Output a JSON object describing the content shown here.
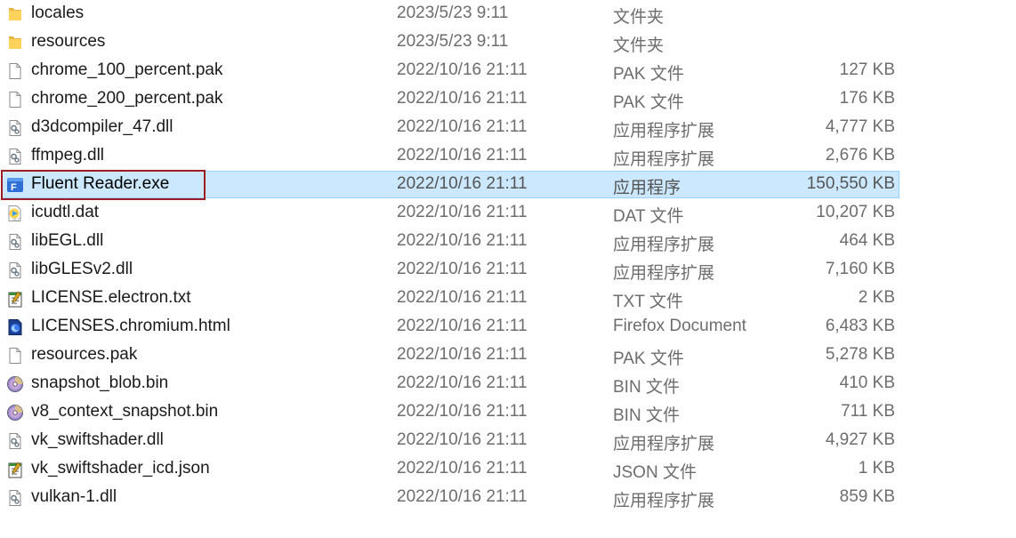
{
  "files": [
    {
      "name": "locales",
      "date": "2023/5/23 9:11",
      "type": "文件夹",
      "size": "",
      "icon": "folder-icon",
      "selected": false
    },
    {
      "name": "resources",
      "date": "2023/5/23 9:11",
      "type": "文件夹",
      "size": "",
      "icon": "folder-icon",
      "selected": false
    },
    {
      "name": "chrome_100_percent.pak",
      "date": "2022/10/16 21:11",
      "type": "PAK 文件",
      "size": "127 KB",
      "icon": "blank-file-icon",
      "selected": false
    },
    {
      "name": "chrome_200_percent.pak",
      "date": "2022/10/16 21:11",
      "type": "PAK 文件",
      "size": "176 KB",
      "icon": "blank-file-icon",
      "selected": false
    },
    {
      "name": "d3dcompiler_47.dll",
      "date": "2022/10/16 21:11",
      "type": "应用程序扩展",
      "size": "4,777 KB",
      "icon": "dll-file-icon",
      "selected": false
    },
    {
      "name": "ffmpeg.dll",
      "date": "2022/10/16 21:11",
      "type": "应用程序扩展",
      "size": "2,676 KB",
      "icon": "dll-file-icon",
      "selected": false
    },
    {
      "name": "Fluent Reader.exe",
      "date": "2022/10/16 21:11",
      "type": "应用程序",
      "size": "150,550 KB",
      "icon": "fluent-reader-app-icon",
      "selected": true
    },
    {
      "name": "icudtl.dat",
      "date": "2022/10/16 21:11",
      "type": "DAT 文件",
      "size": "10,207 KB",
      "icon": "media-player-file-icon",
      "selected": false
    },
    {
      "name": "libEGL.dll",
      "date": "2022/10/16 21:11",
      "type": "应用程序扩展",
      "size": "464 KB",
      "icon": "dll-file-icon",
      "selected": false
    },
    {
      "name": "libGLESv2.dll",
      "date": "2022/10/16 21:11",
      "type": "应用程序扩展",
      "size": "7,160 KB",
      "icon": "dll-file-icon",
      "selected": false
    },
    {
      "name": "LICENSE.electron.txt",
      "date": "2022/10/16 21:11",
      "type": "TXT 文件",
      "size": "2 KB",
      "icon": "notepad-file-icon",
      "selected": false
    },
    {
      "name": "LICENSES.chromium.html",
      "date": "2022/10/16 21:11",
      "type": "Firefox Document",
      "size": "6,483 KB",
      "icon": "firefox-document-icon",
      "selected": false
    },
    {
      "name": "resources.pak",
      "date": "2022/10/16 21:11",
      "type": "PAK 文件",
      "size": "5,278 KB",
      "icon": "blank-file-icon",
      "selected": false
    },
    {
      "name": "snapshot_blob.bin",
      "date": "2022/10/16 21:11",
      "type": "BIN 文件",
      "size": "410 KB",
      "icon": "disc-file-icon",
      "selected": false
    },
    {
      "name": "v8_context_snapshot.bin",
      "date": "2022/10/16 21:11",
      "type": "BIN 文件",
      "size": "711 KB",
      "icon": "disc-file-icon",
      "selected": false
    },
    {
      "name": "vk_swiftshader.dll",
      "date": "2022/10/16 21:11",
      "type": "应用程序扩展",
      "size": "4,927 KB",
      "icon": "dll-file-icon",
      "selected": false
    },
    {
      "name": "vk_swiftshader_icd.json",
      "date": "2022/10/16 21:11",
      "type": "JSON 文件",
      "size": "1 KB",
      "icon": "notepad-file-icon",
      "selected": false
    },
    {
      "name": "vulkan-1.dll",
      "date": "2022/10/16 21:11",
      "type": "应用程序扩展",
      "size": "859 KB",
      "icon": "dll-file-icon",
      "selected": false
    }
  ]
}
